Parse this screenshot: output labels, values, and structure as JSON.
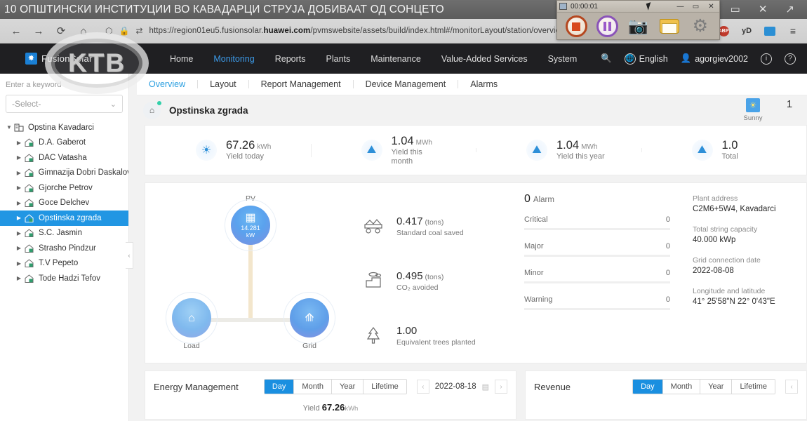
{
  "news": {
    "headline": "10 ОПШТИНСКИ ИНСТИТУЦИИ ВО КАВАДАРЦИ СТРУЈА ДОБИВААТ ОД СОНЦЕТО"
  },
  "window_controls": {
    "minimize": "—",
    "maximize": "▭",
    "close": "✕",
    "share": "↗"
  },
  "browser": {
    "back": "←",
    "forward": "→",
    "reload": "⟳",
    "home": "⌂",
    "shield_icon": "shield-icon",
    "lock_icon": "lock-icon",
    "reader_icon": "reader-icon",
    "url_prefix": "https://region01eu5.fusionsolar.",
    "url_domain": "huawei.com",
    "url_suffix": "/pvmswebsite/assets/build/index.html#/monitorLayout/station/overview",
    "toolbar": {
      "library": "⦀⦀",
      "adblock": "ABP",
      "yandex": "yD",
      "cast": "cast-icon",
      "menu": "≡"
    }
  },
  "recorder": {
    "timer": "00:00:01",
    "minimize": "—",
    "maximize": "▭",
    "close": "✕",
    "buttons": [
      "stop-record-button",
      "pause-record-button",
      "screenshot-button",
      "open-folder-button",
      "settings-button"
    ]
  },
  "watermark": {
    "text": "KTB"
  },
  "topnav": {
    "brand": "FusionSolar",
    "menu": [
      {
        "label": "Home",
        "active": false
      },
      {
        "label": "Monitoring",
        "active": true
      },
      {
        "label": "Reports",
        "active": false
      },
      {
        "label": "Plants",
        "active": false
      },
      {
        "label": "Maintenance",
        "active": false
      },
      {
        "label": "Value-Added Services",
        "active": false
      },
      {
        "label": "System",
        "active": false
      }
    ],
    "search_icon": "🔍",
    "language": "English",
    "user": "agorgiev2002",
    "info_icon": "i",
    "help_icon": "?"
  },
  "subtabs": [
    {
      "label": "Overview",
      "active": true
    },
    {
      "label": "Layout",
      "active": false
    },
    {
      "label": "Report Management",
      "active": false
    },
    {
      "label": "Device Management",
      "active": false
    },
    {
      "label": "Alarms",
      "active": false
    }
  ],
  "sidebar": {
    "search_placeholder": "Enter a keyword",
    "select_value": "-Select-",
    "tree": [
      {
        "label": "Opstina Kavadarci",
        "type": "org",
        "level": 0,
        "expanded": true,
        "selected": false
      },
      {
        "label": "D.A. Gaberot",
        "type": "plant",
        "level": 1,
        "expanded": false,
        "selected": false
      },
      {
        "label": "DAC Vatasha",
        "type": "plant",
        "level": 1,
        "expanded": false,
        "selected": false
      },
      {
        "label": "Gimnazija Dobri Daskalov",
        "type": "plant",
        "level": 1,
        "expanded": false,
        "selected": false
      },
      {
        "label": "Gjorche Petrov",
        "type": "plant",
        "level": 1,
        "expanded": false,
        "selected": false
      },
      {
        "label": "Goce Delchev",
        "type": "plant",
        "level": 1,
        "expanded": false,
        "selected": false
      },
      {
        "label": "Opstinska zgrada",
        "type": "plant",
        "level": 1,
        "expanded": false,
        "selected": true
      },
      {
        "label": "S.C. Jasmin",
        "type": "plant",
        "level": 1,
        "expanded": false,
        "selected": false
      },
      {
        "label": "Strasho Pindzur",
        "type": "plant",
        "level": 1,
        "expanded": false,
        "selected": false
      },
      {
        "label": "T.V Pepeto",
        "type": "plant",
        "level": 1,
        "expanded": false,
        "selected": false
      },
      {
        "label": "Tode Hadzi Tefov",
        "type": "plant",
        "level": 1,
        "expanded": false,
        "selected": false
      }
    ],
    "collapse_icon": "‹"
  },
  "plant": {
    "name": "Opstinska zgrada",
    "home_icon": "⌂",
    "weather": {
      "condition": "Sunny",
      "temperature": "1"
    }
  },
  "kpis": [
    {
      "value": "67.26",
      "unit": "kWh",
      "label": "Yield today",
      "icon": "sun-icon"
    },
    {
      "value": "1.04",
      "unit": "MWh",
      "label": "Yield this month",
      "icon": "panel-month-icon"
    },
    {
      "value": "1.04",
      "unit": "MWh",
      "label": "Yield this year",
      "icon": "panel-year-icon"
    },
    {
      "value": "1.0",
      "unit": "",
      "label": "Total",
      "icon": "panel-total-icon"
    }
  ],
  "flow": {
    "pv": {
      "label": "PV",
      "value": "14.281",
      "unit": "kW",
      "icon": "solar-panel-icon"
    },
    "load": {
      "label": "Load",
      "icon": "house-icon"
    },
    "grid": {
      "label": "Grid",
      "icon": "pylon-icon"
    }
  },
  "eco": [
    {
      "value": "0.417",
      "unit": "(tons)",
      "label": "Standard coal saved",
      "icon": "coal-cart-icon"
    },
    {
      "value": "0.495",
      "unit": "(tons)",
      "label": "CO₂ avoided",
      "icon": "factory-icon"
    },
    {
      "value": "1.00",
      "unit": "",
      "label": "Equivalent trees planted",
      "icon": "tree-icon"
    }
  ],
  "alarms": {
    "total": "0",
    "title": "Alarm",
    "levels": [
      {
        "label": "Critical",
        "count": "0"
      },
      {
        "label": "Major",
        "count": "0"
      },
      {
        "label": "Minor",
        "count": "0"
      },
      {
        "label": "Warning",
        "count": "0"
      }
    ]
  },
  "plant_info": [
    {
      "key": "Plant address",
      "value": "C2M6+5W4, Kavadarci"
    },
    {
      "key": "Total string capacity",
      "value": "40.000 kWp"
    },
    {
      "key": "Grid connection date",
      "value": "2022-08-08"
    },
    {
      "key": "Longitude and latitude",
      "value": "41° 25'58\"N   22° 0'43\"E"
    }
  ],
  "energy_management": {
    "title": "Energy Management",
    "ranges": [
      {
        "label": "Day",
        "active": true
      },
      {
        "label": "Month",
        "active": false
      },
      {
        "label": "Year",
        "active": false
      },
      {
        "label": "Lifetime",
        "active": false
      }
    ],
    "prev": "‹",
    "next": "›",
    "date": "2022-08-18",
    "calendar_icon": "▤",
    "summary_label": "Yield",
    "summary_value": "67.26",
    "summary_unit": "kWh"
  },
  "revenue": {
    "title": "Revenue",
    "ranges": [
      {
        "label": "Day",
        "active": true
      },
      {
        "label": "Month",
        "active": false
      },
      {
        "label": "Year",
        "active": false
      },
      {
        "label": "Lifetime",
        "active": false
      }
    ],
    "prev": "‹"
  },
  "colors": {
    "accent": "#1a8fe0",
    "nav_active": "#3c9ae8",
    "nav_bg": "#1f1f22",
    "selected_row": "#2196e3",
    "status_green": "#31d0aa"
  }
}
